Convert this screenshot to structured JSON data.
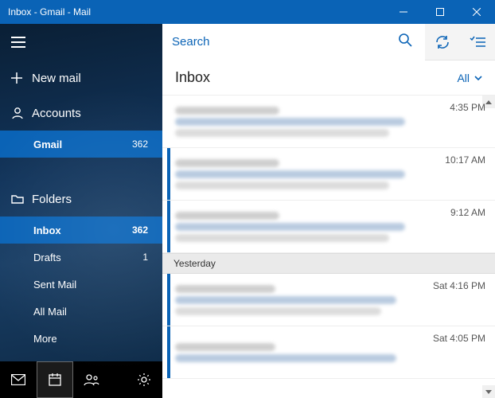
{
  "window": {
    "title": "Inbox - Gmail - Mail"
  },
  "sidebar": {
    "new_mail_label": "New mail",
    "accounts_label": "Accounts",
    "account": {
      "name": "Gmail",
      "unread": "362"
    },
    "folders_label": "Folders",
    "folders": [
      {
        "label": "Inbox",
        "count": "362",
        "selected": true
      },
      {
        "label": "Drafts",
        "count": "1",
        "selected": false
      },
      {
        "label": "Sent Mail",
        "count": "",
        "selected": false
      },
      {
        "label": "All Mail",
        "count": "",
        "selected": false
      },
      {
        "label": "More",
        "count": "",
        "selected": false
      }
    ]
  },
  "search": {
    "placeholder": "Search"
  },
  "header": {
    "folder_name": "Inbox",
    "filter_label": "All"
  },
  "groups": {
    "yesterday": "Yesterday"
  },
  "messages": [
    {
      "time": "4:35 PM",
      "unread": false
    },
    {
      "time": "10:17 AM",
      "unread": true
    },
    {
      "time": "9:12 AM",
      "unread": true
    },
    {
      "time": "Sat 4:16 PM",
      "unread": true
    },
    {
      "time": "Sat 4:05 PM",
      "unread": true
    }
  ],
  "colors": {
    "accent": "#0a63b6"
  }
}
